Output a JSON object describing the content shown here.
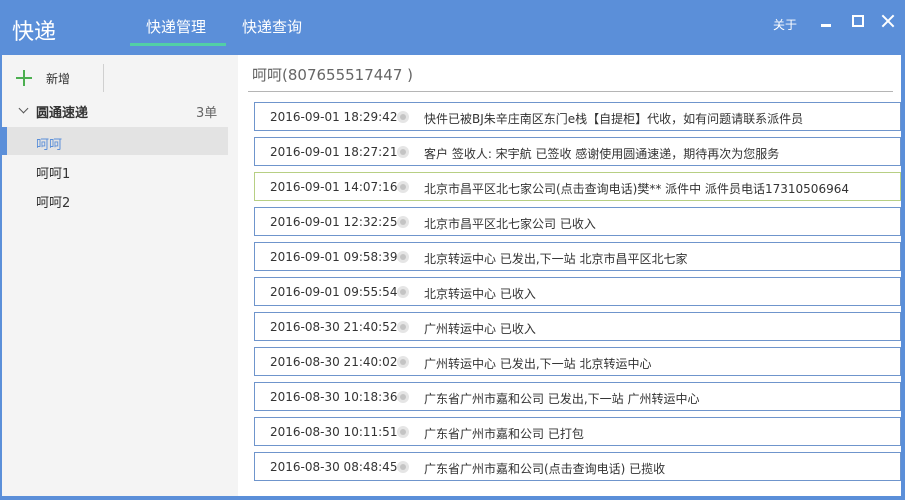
{
  "app": {
    "title": "快递"
  },
  "tabs": [
    {
      "label": "快递管理"
    },
    {
      "label": "快递查询"
    }
  ],
  "window_controls": {
    "about_label": "关于"
  },
  "sidebar": {
    "new_label": "新增",
    "group": {
      "name": "圆通速递",
      "count": "3单"
    },
    "items": [
      {
        "label": "呵呵"
      },
      {
        "label": "呵呵1"
      },
      {
        "label": "呵呵2"
      }
    ]
  },
  "main": {
    "header": "呵呵(807655517447 )",
    "records": [
      {
        "time": "2016-09-01 18:29:42",
        "text": "快件已被BJ朱辛庄南区东门e栈【自提柜】代收，如有问题请联系派件员"
      },
      {
        "time": "2016-09-01 18:27:21",
        "text": "客户 签收人: 宋宇航 已签收 感谢使用圆通速递，期待再次为您服务"
      },
      {
        "time": "2016-09-01 14:07:16",
        "text": "北京市昌平区北七家公司(点击查询电话)樊** 派件中 派件员电话17310506964"
      },
      {
        "time": "2016-09-01 12:32:25",
        "text": "北京市昌平区北七家公司 已收入"
      },
      {
        "time": "2016-09-01 09:58:39",
        "text": "北京转运中心 已发出,下一站 北京市昌平区北七家"
      },
      {
        "time": "2016-09-01 09:55:54",
        "text": "北京转运中心 已收入"
      },
      {
        "time": "2016-08-30 21:40:52",
        "text": "广州转运中心 已收入"
      },
      {
        "time": "2016-08-30 21:40:02",
        "text": "广州转运中心 已发出,下一站 北京转运中心"
      },
      {
        "time": "2016-08-30 10:18:36",
        "text": "广东省广州市嘉和公司 已发出,下一站 广州转运中心"
      },
      {
        "time": "2016-08-30 10:11:51",
        "text": "广东省广州市嘉和公司 已打包"
      },
      {
        "time": "2016-08-30 08:48:45",
        "text": "广东省广州市嘉和公司(点击查询电话) 已揽收"
      }
    ]
  }
}
